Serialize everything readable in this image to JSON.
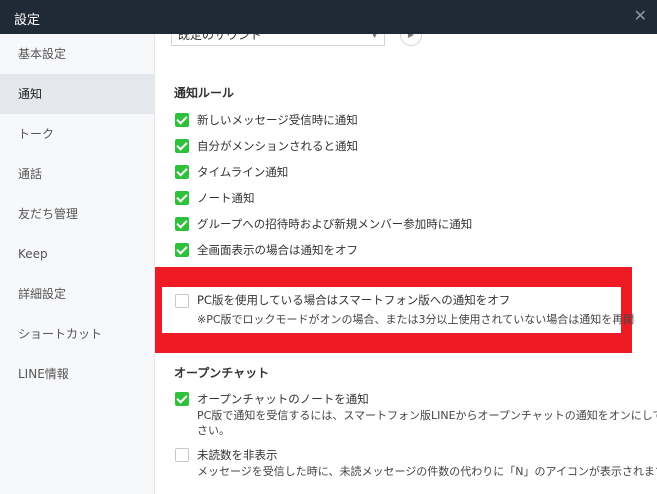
{
  "window": {
    "title": "設定",
    "close_icon": "close-icon"
  },
  "sidebar": {
    "items": [
      {
        "label": "基本設定",
        "active": false
      },
      {
        "label": "通知",
        "active": true
      },
      {
        "label": "トーク",
        "active": false
      },
      {
        "label": "通話",
        "active": false
      },
      {
        "label": "友だち管理",
        "active": false
      },
      {
        "label": "Keep",
        "active": false
      },
      {
        "label": "詳細設定",
        "active": false
      },
      {
        "label": "ショートカット",
        "active": false
      },
      {
        "label": "LINE情報",
        "active": false
      }
    ]
  },
  "sound": {
    "selected": "既定のサウンド",
    "play_icon": "play-icon"
  },
  "notification_rules": {
    "title": "通知ルール",
    "items": [
      {
        "label": "新しいメッセージ受信時に通知",
        "checked": true
      },
      {
        "label": "自分がメンションされると通知",
        "checked": true
      },
      {
        "label": "タイムライン通知",
        "checked": true
      },
      {
        "label": "ノート通知",
        "checked": true
      },
      {
        "label": "グループへの招待時および新規メンバー参加時に通知",
        "checked": true
      },
      {
        "label": "全画面表示の場合は通知をオフ",
        "checked": true
      }
    ],
    "pc_option": {
      "label": "PC版を使用している場合はスマートフォン版への通知をオフ",
      "note": "※PC版でロックモードがオンの場合、または3分以上使用されていない場合は通知を再開",
      "checked": false
    }
  },
  "open_chat": {
    "title": "オープンチャット",
    "note_notify": {
      "label": "オープンチャットのノートを通知",
      "desc_line1": "PC版で通知を受信するには、スマートフォン版LINEからオープンチャットの通知をオンにしてくだ",
      "desc_line2": "さい。",
      "checked": true
    },
    "hide_unread": {
      "label": "未読数を非表示",
      "desc": "メッセージを受信した時に、未読メッセージの件数の代わりに「N」のアイコンが表示されます。",
      "checked": false
    }
  },
  "colors": {
    "titlebar": "#202a37",
    "check_on": "#2fc13b",
    "highlight": "#ee1b24"
  }
}
